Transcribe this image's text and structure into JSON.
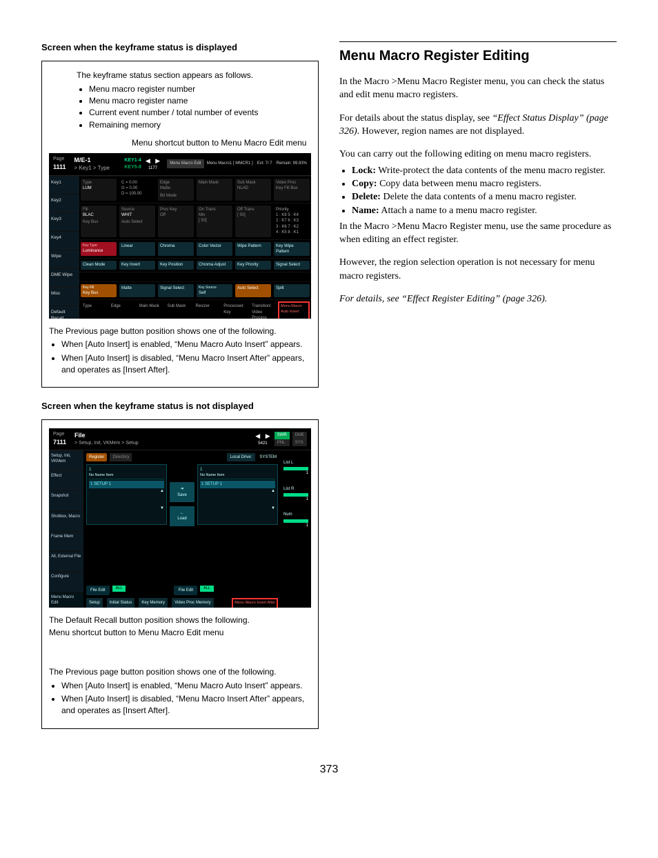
{
  "left": {
    "heading1": "Screen when the keyframe status is displayed",
    "figA": {
      "intro": "The keyframe status section appears as follows.",
      "bullets": [
        "Menu macro register number",
        "Menu macro register name",
        "Current event number / total number of events",
        "Remaining memory"
      ],
      "shortcut": "Menu shortcut button to Menu Macro Edit menu",
      "page_label": "Page",
      "page_num": "1111",
      "title": "M/E-1",
      "crumb": "> Key1 > Type",
      "keys1": "KEY1-4",
      "keys2": "KEY5-8",
      "event_num": "1177",
      "editbtn": "Menu Macro Edit",
      "macro_name": "Menu Macro1 [ MMCR1 ]",
      "evt": "Evt:  7/  7",
      "remain": "Remain: 99.93%",
      "rows": [
        "Key1",
        "Key2",
        "Key3",
        "Key4",
        "Wipe",
        "DME Wipe",
        "Misc",
        "Default Recall"
      ],
      "r1": {
        "l0": "Type",
        "c0": "LUM",
        "c1a": "C = 0.00",
        "c1b": "G = 0.00",
        "c1c": "D = 100.00",
        "l2": "Edge",
        "c2": "Matte",
        "c2b": "Brl Mode",
        "l3": "Main Mask",
        "l4": "Sub Mask",
        "c4": "NLAD",
        "l5": "Video Proc",
        "c5": "Key Fill Bus"
      },
      "r2": {
        "l0": "Fill",
        "c0": "BLAC",
        "l1": "Source",
        "c1": "WHIT",
        "l2": "Proc Key",
        "c2": "Off",
        "l3": "On Trans",
        "c3": "Mix",
        "l4": "Off Trans",
        "l5": "Priority",
        "p": [
          "1 : K8 5 : K4",
          "2 : K7 6 : K3",
          "3 : K6 7 : K2",
          "4 : K5 8 : K1"
        ]
      },
      "r2b": {
        "c0": "Key Bus",
        "c1": "Auto Select",
        "c2": "[ 50]",
        "c3": "[ 50]"
      },
      "r3": {
        "l0": "Key Type",
        "c0": "Luminance",
        "c1": "Linear",
        "c2": "Chroma",
        "c3": "Color Vector",
        "c4": "Wipe Pattern",
        "c5": "Key Wipe Pattern"
      },
      "r4": {
        "c0": "Clean Mode",
        "c1": "Key Invert",
        "c2": "Key Position",
        "c3": "Chroma Adjust",
        "c4": "Key Priority",
        "c5": "Signal Select"
      },
      "r5": {
        "l0": "Key Fill",
        "c0": "Key Bus",
        "c1": "Matte",
        "c2": "Signal Select",
        "l1": "Key Source",
        "c3": "Self",
        "c4": "Auto Select",
        "c5": "Split"
      },
      "r6": {
        "c0": "Type",
        "c1": "Edge",
        "c2": "Main Mask",
        "c3": "Sub Mask",
        "c4": "Resizer",
        "c5": "Processed Key",
        "c6": "Transition/ Video Process"
      },
      "redbtn": "Menu Macro Auto Insert",
      "after_intro": "The Previous page button position shows one of the following.",
      "after1": "When [Auto Insert] is enabled, “Menu Macro Auto Insert” appears.",
      "after2": "When [Auto Insert] is disabled, “Menu Macro Insert After” appears, and operates as [Insert After]."
    },
    "heading2": "Screen when the keyframe status is not displayed",
    "figB": {
      "page_label": "Page",
      "page_num": "7111",
      "title": "File",
      "crumb": "> Setup, Init, VKMem > Setup",
      "event_num": "5421",
      "tabs": [
        "SWR",
        "DME",
        "PNL",
        "SYS"
      ],
      "side": [
        "Setup, Init, VKMem",
        "Effect",
        "Snapshot",
        "Shotbox, Macro",
        "Frame Mem",
        "All, External File",
        "Configure",
        "Menu Macro Edit"
      ],
      "top_reg": "Register",
      "top_dir": "Directory",
      "local": "Local Drive:",
      "system": "SYSTEM",
      "col_hdr": "No  Name             Item",
      "col_row": "1    SETUP            1",
      "save": "Save",
      "load": "Load",
      "fileedit": "File Edit",
      "all": "ALL",
      "bot": [
        "Setup",
        "Initial Status",
        "Key Memory",
        "Video Proc Memory"
      ],
      "redbtn": "Menu Macro Insert After",
      "rside": [
        {
          "label": "List L",
          "num": "1"
        },
        {
          "label": "List R",
          "num": "1"
        },
        {
          "label": "Num",
          "num": "1"
        }
      ],
      "caption1": "The Default Recall button position shows the following.",
      "caption2": "Menu shortcut button to Menu Macro Edit menu",
      "after_intro": "The Previous page button position shows one of the following.",
      "after1": "When [Auto Insert] is enabled, “Menu Macro Auto Insert” appears.",
      "after2": "When [Auto Insert] is disabled, “Menu Macro Insert After” appears, and operates as [Insert After]."
    }
  },
  "right": {
    "title": "Menu Macro Register Editing",
    "p1": "In the Macro >Menu Macro Register menu, you can check the status and edit menu macro registers.",
    "p2a": "For details about the status display, see ",
    "p2b": "“Effect Status Display” (page 326)",
    "p2c": ". However, region names are not displayed.",
    "p3": "You can carry out the following editing on menu macro registers.",
    "li1a": "Lock:",
    "li1b": " Write-protect the data contents of the menu macro register.",
    "li2a": "Copy:",
    "li2b": " Copy data between menu macro registers.",
    "li3a": "Delete:",
    "li3b": " Delete the data contents of a menu macro register.",
    "li4a": "Name:",
    "li4b": " Attach a name to a menu macro register.",
    "p4": "In the Macro >Menu Macro Register menu, use the same procedure as when editing an effect register.",
    "p5": "However, the region selection operation is not necessary for menu macro registers.",
    "p6": "For details, see “Effect Register Editing” (page 326)."
  },
  "page_number": "373"
}
